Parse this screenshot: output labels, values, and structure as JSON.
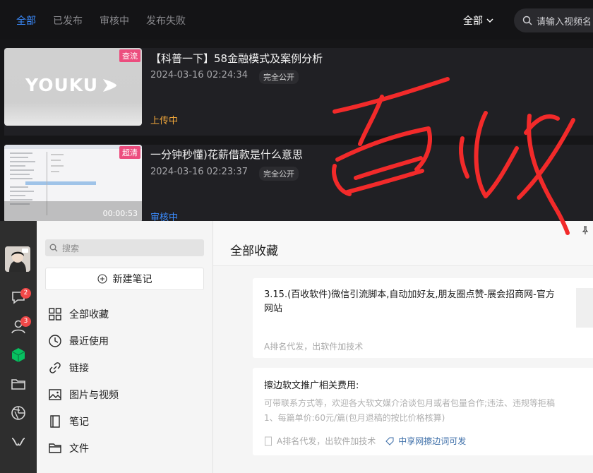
{
  "video_manager": {
    "tabs": [
      "全部",
      "已发布",
      "审核中",
      "发布失败"
    ],
    "filter_label": "全部",
    "search_placeholder": "请输入视频名",
    "videos": [
      {
        "badge": "查流",
        "thumb_text": "YOUKU",
        "title": "【科普一下】58金融模式及案例分析",
        "date": "2024-03-16 02:24:34",
        "visibility": "完全公开",
        "status": "上传中",
        "status_color": "#f2a83b"
      },
      {
        "badge": "超清",
        "duration": "00:00:53",
        "title": "一分钟秒懂)花薪借款是什么意思",
        "date": "2024-03-16 02:23:37",
        "visibility": "完全公开",
        "status": "审核中",
        "status_color": "#3b8cff"
      }
    ]
  },
  "overlay_text": "百收",
  "wechat": {
    "badges": {
      "chat": "2",
      "contacts": "3"
    },
    "search_placeholder": "搜索",
    "new_note": "新建笔记",
    "nav": [
      "全部收藏",
      "最近使用",
      "链接",
      "图片与视频",
      "笔记",
      "文件"
    ],
    "header_title": "全部收藏",
    "cards": [
      {
        "title": "3.15.(百收软件)微信引流脚本,自动加好友,朋友圈点赞-展会招商网-官方网站",
        "source": "A排名代发，出软件加技术"
      },
      {
        "title": "擦边软文推广相关费用:",
        "lines": [
          "可带联系方式等，欢迎各大软文媒介洽谈包月或者包量合作;违法、违规等拒稿",
          "1、每篇单价:60元/篇(包月退稿的按比价格核算)"
        ],
        "source": "A排名代发，出软件加技术",
        "tag": "中享网擦边词可发"
      }
    ]
  },
  "colors": {
    "accent_blue": "#3b8cff",
    "upload_orange": "#f2a83b",
    "badge_pink": "#ec4d7e",
    "scribble_red": "#f22a2a",
    "wechat_green": "#07c160"
  }
}
